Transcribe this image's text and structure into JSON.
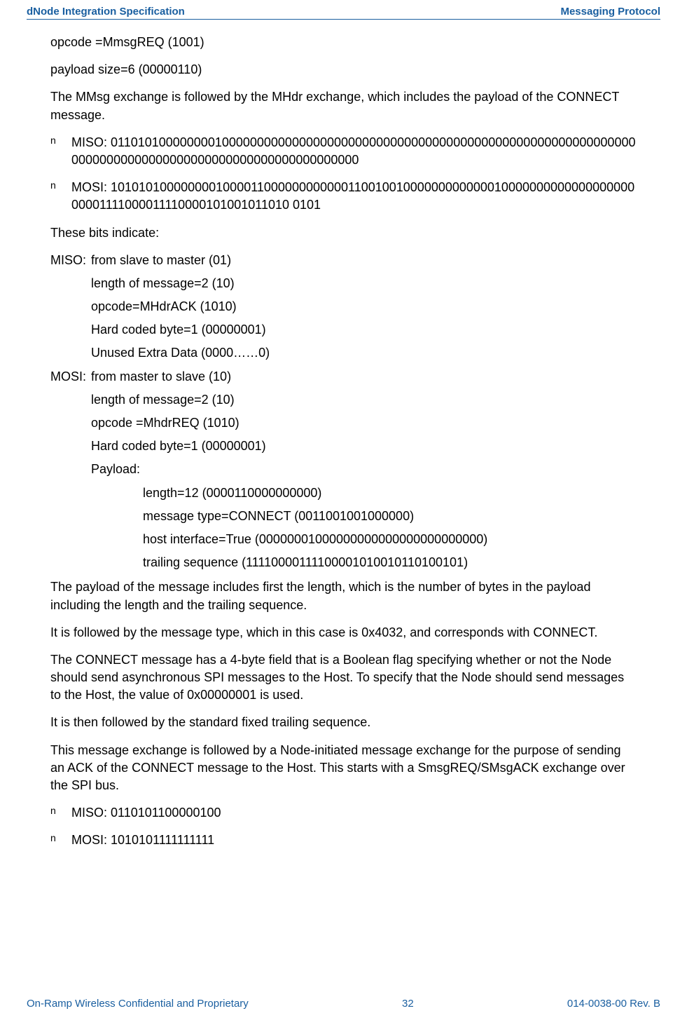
{
  "header": {
    "left": "dNode Integration Specification",
    "right": "Messaging Protocol"
  },
  "lines": {
    "opcode1": "opcode =MmsgREQ (1001)",
    "payload1": "payload size=6 (00000110)",
    "para1": "The MMsg exchange is followed by the MHdr exchange, which includes the payload of the CONNECT message.",
    "miso_bits": "MISO: 01101010000000010000000000000000000000000000000000000000000000000000000000000000000000000000000000000000000000000000",
    "mosi_bits": "MOSI: 10101010000000010000110000000000001100100100000000000001000000000000000000000001111000011110000101001011010 0101",
    "bits_indicate": "These bits indicate:",
    "miso_label": "MISO:",
    "miso_1": "from slave to master (01)",
    "miso_2": "length of message=2 (10)",
    "miso_3": "opcode=MHdrACK (1010)",
    "miso_4": "Hard coded byte=1 (00000001)",
    "miso_5": "Unused Extra Data (0000……0)",
    "mosi_label": "MOSI:",
    "mosi_1": "from master to slave (10)",
    "mosi_2": "length of message=2 (10)",
    "mosi_3": "opcode =MhdrREQ (1010)",
    "mosi_4": "Hard coded byte=1 (00000001)",
    "mosi_5": "Payload:",
    "pl_1": "length=12 (0000110000000000)",
    "pl_2": "message type=CONNECT (0011001001000000)",
    "pl_3": "host interface=True (00000001000000000000000000000000)",
    "pl_4": "trailing sequence (11110000111100001010010110100101)",
    "para2": "The payload of the message includes first the length, which is the number of bytes in the payload including the length and the trailing sequence.",
    "para3": "It is followed by the message type, which in this case is 0x4032, and corresponds with CONNECT.",
    "para4": "The CONNECT message has a 4-byte field that is a Boolean flag specifying whether or not the Node should send asynchronous SPI messages to the Host. To specify that the Node should send messages to the Host, the value of 0x00000001 is used.",
    "para5": "It is then followed by the standard fixed trailing sequence.",
    "para6": "This message exchange is followed by a Node-initiated message exchange for the purpose of sending an ACK of the CONNECT message to the Host. This starts with a SmsgREQ/SMsgACK exchange over the SPI bus.",
    "miso2": "MISO: 0110101100000100",
    "mosi2": "MOSI: 1010101111111111"
  },
  "bullet_glyph": "n",
  "footer": {
    "left": "On-Ramp Wireless Confidential and Proprietary",
    "center": "32",
    "right": "014-0038-00 Rev. B"
  }
}
